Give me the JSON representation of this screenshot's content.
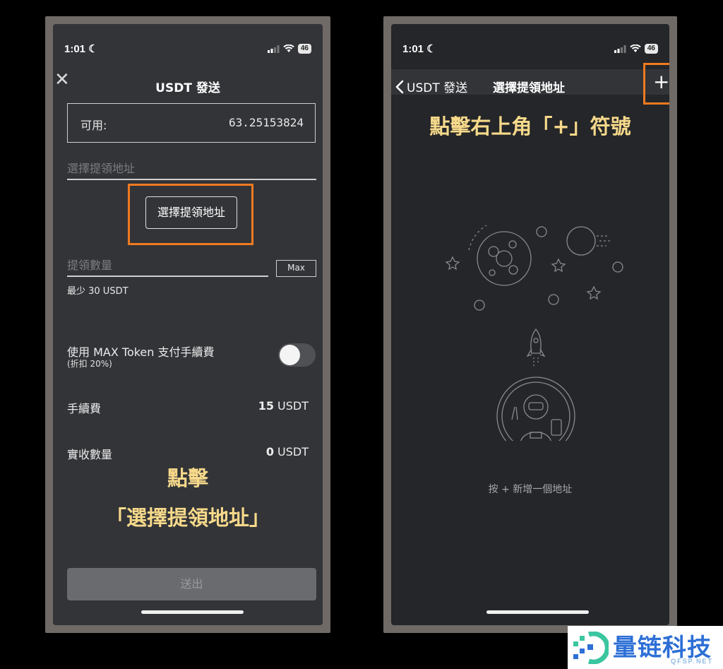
{
  "status": {
    "time": "1:01",
    "battery": "46"
  },
  "left": {
    "title": "USDT 發送",
    "available_label": "可用:",
    "available_value": "63.25153824",
    "address_placeholder": "選擇提領地址",
    "select_address_button": "選擇提領地址",
    "amount_placeholder": "提領數量",
    "max_button": "Max",
    "minimum_note": "最少 30 USDT",
    "max_token_label": "使用 MAX Token 支付手續費",
    "max_token_discount": "(折扣 20%)",
    "max_token_toggle_on": false,
    "fee_label": "手續費",
    "fee_amount": "15",
    "fee_unit": " USDT",
    "received_label": "實收數量",
    "received_amount": "0",
    "received_unit": " USDT",
    "annotation_line1": "點擊",
    "annotation_line2": "「選擇提領地址」",
    "submit_button": "送出"
  },
  "right": {
    "back_label": "USDT 發送",
    "title": "選擇提領地址",
    "add_button": "+",
    "annotation": "點擊右上角「+」符號",
    "empty_hint": "按 + 新增一個地址"
  },
  "watermark": {
    "brand": "量链科技",
    "site": "QFSP.NET"
  },
  "colors": {
    "highlight": "#f07a20",
    "annotation": "#f6d98a",
    "brand": "#2d6fd6"
  }
}
